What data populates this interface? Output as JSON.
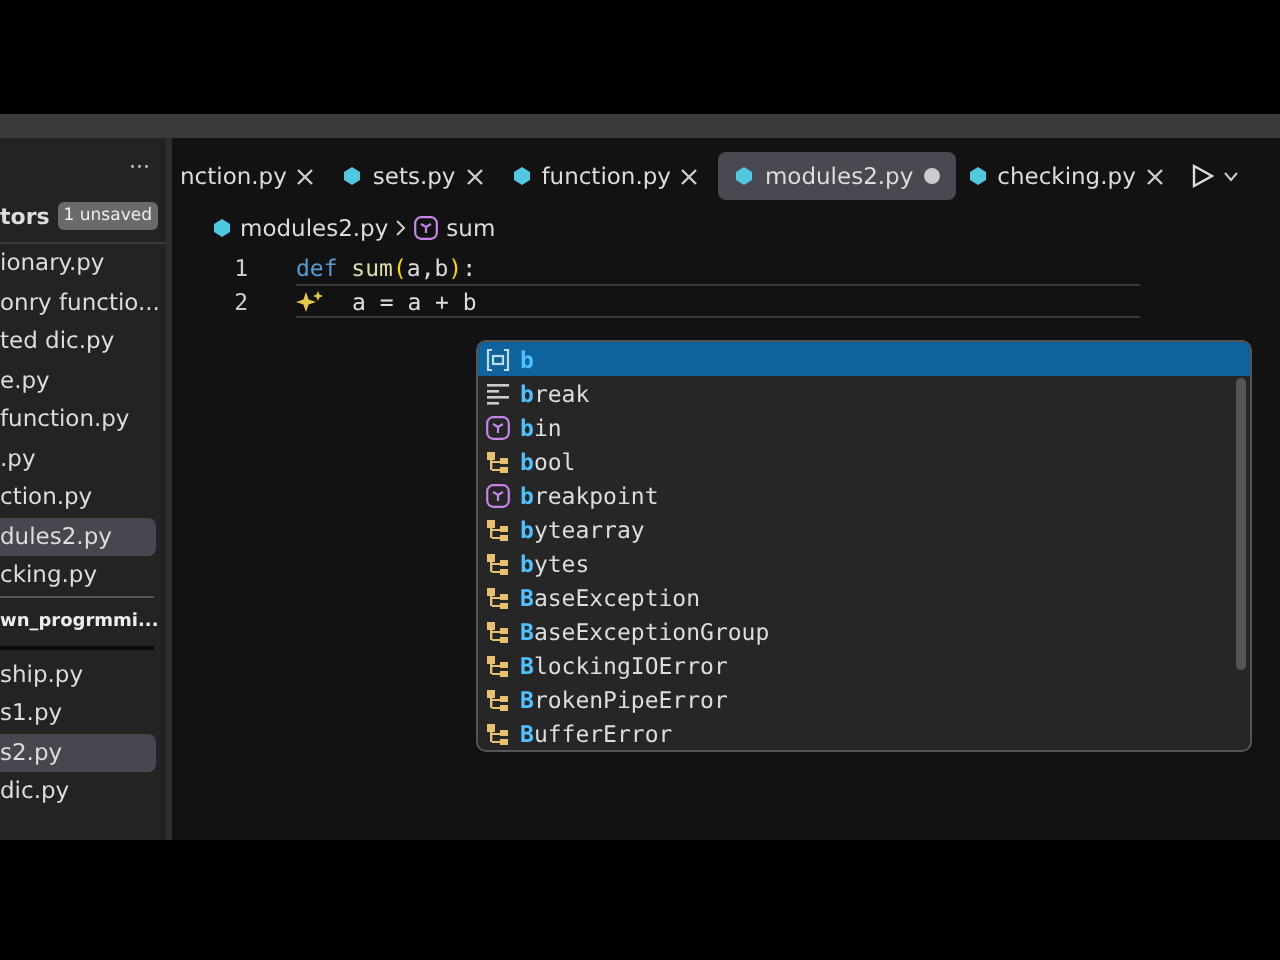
{
  "sidebar": {
    "more": "···",
    "section": {
      "title": "tors",
      "badge": "1 unsaved"
    },
    "open_editors": [
      {
        "label": "ionary.py",
        "selected": false
      },
      {
        "label": "onry functio...",
        "selected": false
      },
      {
        "label": "ted dic.py",
        "selected": false
      },
      {
        "label": "e.py",
        "selected": false
      },
      {
        "label": "function.py",
        "selected": false
      },
      {
        "label": ".py",
        "selected": false
      },
      {
        "label": "ction.py",
        "selected": false
      },
      {
        "label": "dules2.py",
        "selected": true
      },
      {
        "label": "cking.py",
        "selected": false
      }
    ],
    "folder": {
      "title": "wn_progrmmi...",
      "files": [
        {
          "label": "ship.py",
          "selected": false
        },
        {
          "label": "s1.py",
          "selected": false
        },
        {
          "label": "s2.py",
          "selected": true
        },
        {
          "label": "dic.py",
          "selected": false
        }
      ]
    }
  },
  "tabs": [
    {
      "label": "nction.py",
      "selected": false,
      "dirty": false,
      "icon": false
    },
    {
      "label": "sets.py",
      "selected": false,
      "dirty": false,
      "icon": true
    },
    {
      "label": "function.py",
      "selected": false,
      "dirty": false,
      "icon": true
    },
    {
      "label": "modules2.py",
      "selected": true,
      "dirty": true,
      "icon": true
    },
    {
      "label": "checking.py",
      "selected": false,
      "dirty": false,
      "icon": true
    }
  ],
  "breadcrumb": {
    "file": "modules2.py",
    "symbol": "sum"
  },
  "lines": [
    {
      "number": "1",
      "tokens": [
        {
          "kind": "keyword",
          "text": "def"
        },
        {
          "kind": "function",
          "text": "sum"
        },
        {
          "kind": "paren",
          "text": "("
        },
        {
          "kind": "plain",
          "text": "a,b"
        },
        {
          "kind": "paren",
          "text": ")"
        },
        {
          "kind": "plain",
          "text": ":"
        }
      ]
    },
    {
      "number": "2",
      "hint": true,
      "tokens": [
        {
          "kind": "plain",
          "text": "a = a + b"
        }
      ]
    }
  ],
  "suggestions": [
    {
      "kind": "variable",
      "match": "b",
      "selected": true
    },
    {
      "kind": "keyword",
      "match": "b",
      "rest": "reak",
      "selected": false
    },
    {
      "kind": "method",
      "match": "b",
      "rest": "in",
      "selected": false
    },
    {
      "kind": "class",
      "match": "b",
      "rest": "ool",
      "selected": false
    },
    {
      "kind": "method",
      "match": "b",
      "rest": "reakpoint",
      "selected": false
    },
    {
      "kind": "class",
      "match": "b",
      "rest": "ytearray",
      "selected": false
    },
    {
      "kind": "class",
      "match": "b",
      "rest": "ytes",
      "selected": false
    },
    {
      "kind": "class",
      "match": "B",
      "rest": "aseException",
      "selected": false
    },
    {
      "kind": "class",
      "match": "B",
      "rest": "aseExceptionGroup",
      "selected": false
    },
    {
      "kind": "class",
      "match": "B",
      "rest": "lockingIOError",
      "selected": false
    },
    {
      "kind": "class",
      "match": "B",
      "rest": "rokenPipeError",
      "selected": false
    },
    {
      "kind": "class",
      "match": "B",
      "rest": "ufferError",
      "selected": false
    }
  ]
}
